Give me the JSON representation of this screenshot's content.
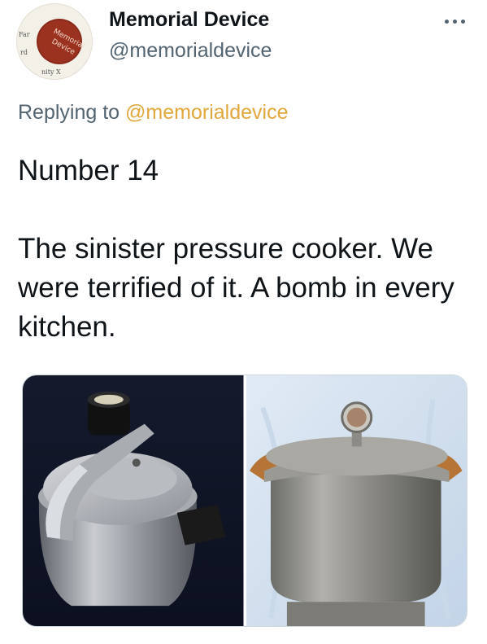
{
  "author": {
    "display_name": "Memorial Device",
    "handle": "@memorialdevice",
    "avatar_icon": "avatar-badge-icon",
    "avatar_text": [
      "Memorial",
      "Device"
    ]
  },
  "menu": {
    "icon": "more-horizontal-icon"
  },
  "reply": {
    "prefix": "Replying to ",
    "mention": "@memorialdevice"
  },
  "tweet": {
    "line1": "Number 14",
    "line2": "The sinister pressure cooker. We were terrified of it. A bomb in every kitchen."
  },
  "media": {
    "photos": [
      {
        "name": "pressure-cooker-photo-1",
        "subject": "pressure-cooker-icon"
      },
      {
        "name": "pressure-cooker-photo-2",
        "subject": "pressure-canner-icon"
      }
    ]
  },
  "colors": {
    "mention": "#e0a73c",
    "secondary_text": "#536471",
    "primary_text": "#0f1419"
  }
}
